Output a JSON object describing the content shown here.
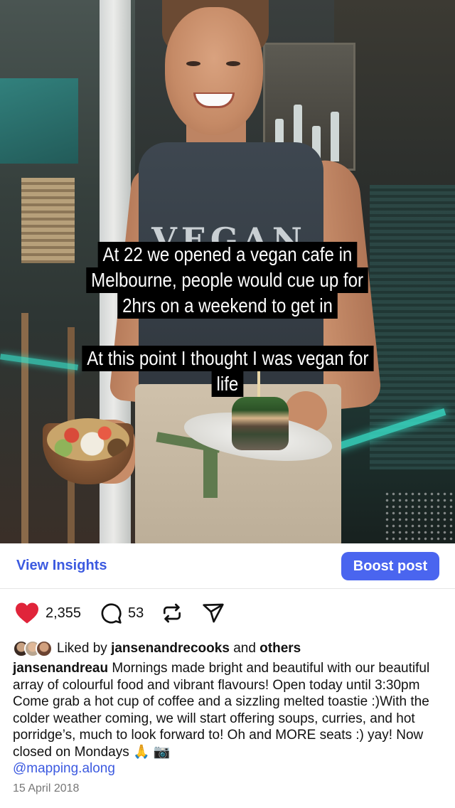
{
  "story": {
    "overlay_line_1": "At 22 we opened a vegan cafe in",
    "overlay_line_2": "Melbourne, people would cue up for",
    "overlay_line_3": "2hrs on a weekend to get in",
    "overlay_line_4": "At this point I thought I was vegan for",
    "overlay_line_5": "life",
    "shirt_print": "VEGAN"
  },
  "insights": {
    "view_label": "View Insights",
    "boost_label": "Boost post"
  },
  "actions": {
    "likes": "2,355",
    "comments": "53",
    "like_color": "#e0243a",
    "icons": [
      "heart-icon",
      "comment-icon",
      "repost-icon",
      "share-icon"
    ]
  },
  "liked_by": {
    "prefix": "Liked by",
    "user": "jansenandrecooks",
    "and": "and",
    "others": "others"
  },
  "caption": {
    "username": "jansenandreau",
    "text": "Mornings made bright and beautiful with our beautiful array of colourful food and vibrant flavours! Open today until 3:30pm Come grab a hot cup of coffee and a sizzling melted toastie :)With the colder weather coming, we will start offering soups, curries, and hot porridge’s, much to look forward to! Oh and MORE seats :) yay! Now closed on Mondays 🙏 📷",
    "mention": "@mapping.along"
  },
  "date": "15 April 2018",
  "colors": {
    "accent": "#4a65ef",
    "link": "#3c5ae0"
  }
}
